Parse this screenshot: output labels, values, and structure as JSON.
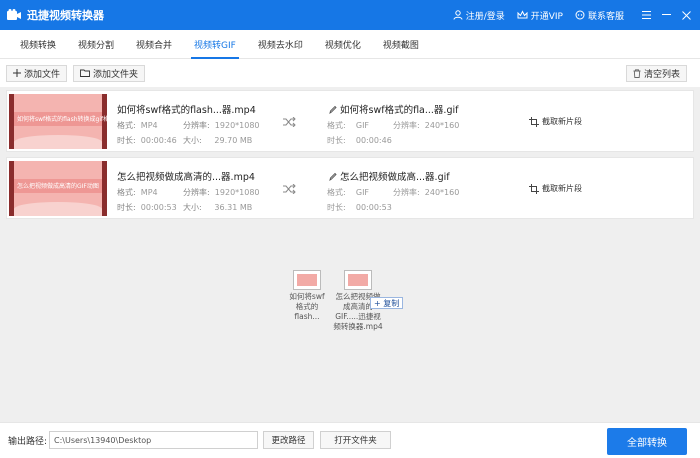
{
  "app": {
    "title": "迅捷视频转换器"
  },
  "header": {
    "login_label": "注册/登录",
    "vip_label": "开通VIP",
    "support_label": "联系客服"
  },
  "tabs": [
    {
      "label": "视频转换",
      "active": false
    },
    {
      "label": "视频分割",
      "active": false
    },
    {
      "label": "视频合并",
      "active": false
    },
    {
      "label": "视频转GIF",
      "active": true
    },
    {
      "label": "视频去水印",
      "active": false
    },
    {
      "label": "视频优化",
      "active": false
    },
    {
      "label": "视频截图",
      "active": false
    }
  ],
  "toolbar": {
    "add_file_label": "添加文件",
    "add_folder_label": "添加文件夹",
    "clear_label": "清空列表"
  },
  "files": [
    {
      "thumb_text": "如何将swf格式的flash转换成gif格式",
      "name": "如何将swf格式的flash...器.mp4",
      "format_label": "格式:",
      "format": "MP4",
      "resolution_label": "分辨率:",
      "resolution": "1920*1080",
      "duration_label": "时长:",
      "duration": "00:00:46",
      "size_label": "大小:",
      "size": "29.70 MB",
      "output_name": "如何将swf格式的fla...器.gif",
      "out_format": "GIF",
      "out_resolution": "240*160",
      "out_duration": "00:00:46",
      "clip_label": "截取新片段"
    },
    {
      "thumb_text": "怎么把视频做成高清的GIF动图",
      "name": "怎么把视频做成高清的...器.mp4",
      "format_label": "格式:",
      "format": "MP4",
      "resolution_label": "分辨率:",
      "resolution": "1920*1080",
      "duration_label": "时长:",
      "duration": "00:00:53",
      "size_label": "大小:",
      "size": "36.31 MB",
      "output_name": "怎么把视频做成高...器.gif",
      "out_format": "GIF",
      "out_resolution": "240*160",
      "out_duration": "00:00:53",
      "clip_label": "截取新片段"
    }
  ],
  "drag": {
    "item1_label": "如何将swf格式的flash...",
    "item2_label": "怎么把视频做成高清的GIF.....迅捷视频转换器.mp4",
    "copy_label": "+ 复制"
  },
  "bottom": {
    "output_label": "输出路径:",
    "output_path": "C:\\Users\\13940\\Desktop",
    "change_path_label": "更改路径",
    "open_folder_label": "打开文件夹",
    "convert_all_label": "全部转换"
  },
  "colors": {
    "accent": "#1677e6",
    "convert_button": "#1c7be9",
    "thumb_pink": "#f4b4b0"
  }
}
